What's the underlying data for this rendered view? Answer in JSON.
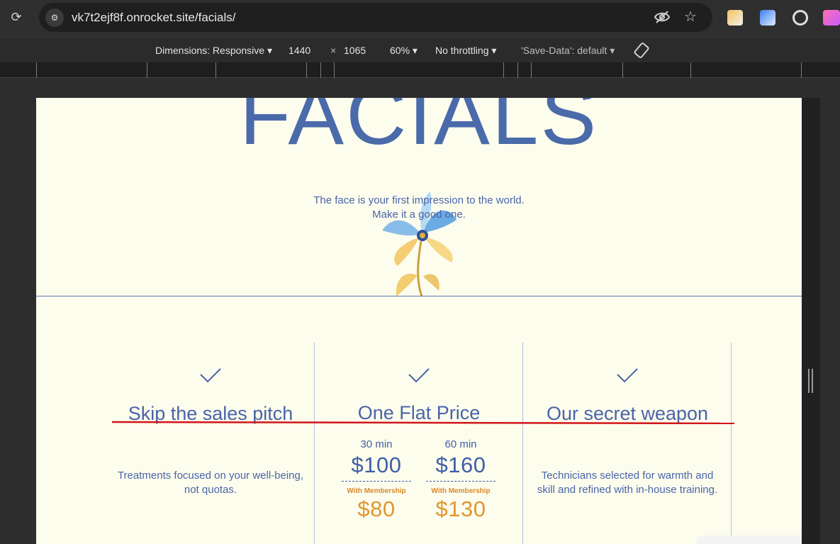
{
  "browser": {
    "url": "vk7t2ejf8f.onrocket.site/facials/"
  },
  "devtools": {
    "dimensions_label": "Dimensions: Responsive ▾",
    "width": "1440",
    "times": "×",
    "height": "1065",
    "zoom": "60% ▾",
    "throttling": "No throttling ▾",
    "save_data": "'Save-Data': default ▾"
  },
  "hero": {
    "title": "FACIALS",
    "tagline_line1": "The face is your first impression to the world.",
    "tagline_line2": "Make it a good one."
  },
  "features": [
    {
      "title": "Skip the sales pitch",
      "text_line1": "Treatments focused on your well-being,",
      "text_line2": "not quotas."
    },
    {
      "title": "One Flat Price",
      "prices": [
        {
          "duration": "30 min",
          "price": "$100",
          "member_label": "With Membership",
          "member_price": "$80"
        },
        {
          "duration": "60 min",
          "price": "$160",
          "member_label": "With Membership",
          "member_price": "$130"
        }
      ]
    },
    {
      "title": "Our secret weapon",
      "text_line1": "Technicians selected for warmth and",
      "text_line2": "skill and refined with in-house training."
    }
  ],
  "colors": {
    "brand_blue": "#4a64a8",
    "accent_orange": "#e0962e",
    "page_bg": "#fdfdee",
    "annotation_red": "#d0161a"
  }
}
